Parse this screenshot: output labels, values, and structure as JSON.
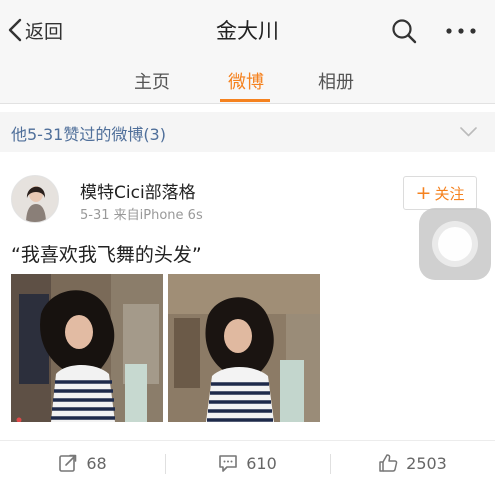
{
  "navbar": {
    "back_label": "返回",
    "title": "金大川"
  },
  "tabs": [
    {
      "label": "主页"
    },
    {
      "label": "微博"
    },
    {
      "label": "相册"
    }
  ],
  "active_tab": "微博",
  "section": {
    "title": "他5-31赞过的微博(3)"
  },
  "post": {
    "author": "模特Cici部落格",
    "date": "5-31",
    "source": "来自iPhone 6s",
    "follow_label": "关注",
    "text": "“我喜欢我飞舞的头发”"
  },
  "actions": {
    "repost_count": "68",
    "comment_count": "610",
    "like_count": "2503"
  },
  "colors": {
    "accent": "#f5821f",
    "link": "#4f6f9a",
    "bar_background": "#f7f7f7"
  },
  "icons": [
    "back-chevron-icon",
    "search-icon",
    "more-icon",
    "chevron-down-icon",
    "repost-icon",
    "comment-icon",
    "like-icon"
  ]
}
